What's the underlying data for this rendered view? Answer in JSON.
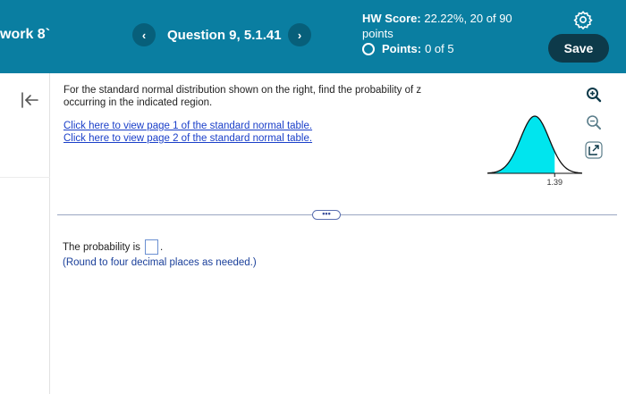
{
  "header": {
    "title_fragment": "work 8`",
    "question_label": "Question 9, 5.1.41",
    "prev_glyph": "‹",
    "next_glyph": "›",
    "hw_score_label": "HW Score:",
    "hw_score_value": "22.22%, 20 of 90",
    "hw_score_unit": "points",
    "points_label": "Points:",
    "points_value": "0 of 5",
    "save_label": "Save"
  },
  "question": {
    "prompt": "For the standard normal distribution shown on the right, find the probability of z occurring in the indicated region.",
    "link_page1": "Click here to view page 1 of the standard normal table.",
    "link_page2": "Click here to view page 2 of the standard normal table.",
    "figure_z_label": "1.39"
  },
  "toolbar": {
    "icons": [
      "zoom-in-icon",
      "zoom-out-icon",
      "open-external-icon"
    ]
  },
  "divider": {
    "more_label": "•••"
  },
  "answer": {
    "label": "The probability is",
    "suffix": ".",
    "value": "",
    "hint": "(Round to four decimal places as needed.)"
  },
  "colors": {
    "header_bg": "#0a7ea1",
    "save_bg": "#0d3a4a",
    "shaded_region": "#00e5ee",
    "link": "#1a3fc9"
  }
}
